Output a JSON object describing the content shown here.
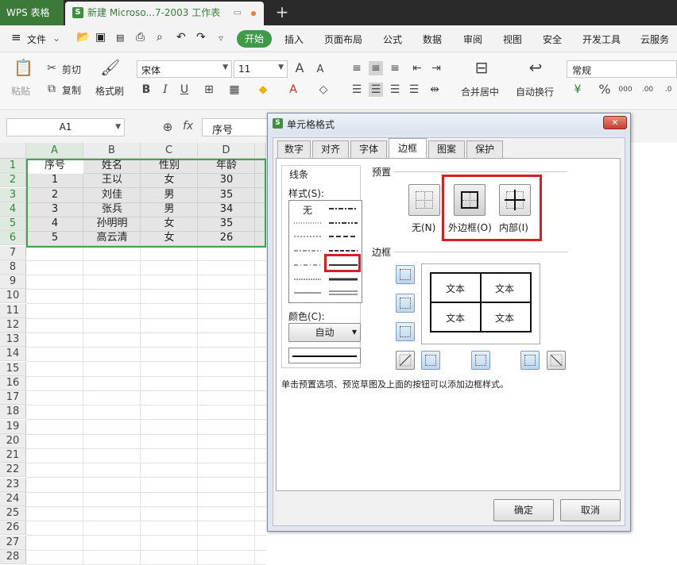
{
  "titlebar": {
    "app": "WPS 表格",
    "doc_title": "新建 Microso...7-2003 工作表"
  },
  "menu": {
    "file": "文件",
    "start": "开始",
    "items": [
      "插入",
      "页面布局",
      "公式",
      "数据",
      "审阅",
      "视图",
      "安全",
      "开发工具",
      "云服务"
    ]
  },
  "ribbon": {
    "paste": "粘贴",
    "cut": "剪切",
    "copy": "复制",
    "format_painter": "格式刷",
    "font_name": "宋体",
    "font_size": "11",
    "merge_center": "合并居中",
    "wrap_text": "自动换行",
    "number_format": "常规"
  },
  "formula": {
    "cell_ref": "A1",
    "fx": "fx",
    "value": "序号"
  },
  "sheet": {
    "columns": [
      "A",
      "B",
      "C",
      "D"
    ],
    "rows": [
      "1",
      "2",
      "3",
      "4",
      "5",
      "6",
      "7",
      "8",
      "9",
      "10",
      "11",
      "12",
      "13",
      "14",
      "15",
      "16",
      "17",
      "18",
      "19",
      "20",
      "21",
      "22",
      "23",
      "24",
      "25",
      "26",
      "27",
      "28"
    ],
    "data": [
      [
        "序号",
        "姓名",
        "性别",
        "年龄"
      ],
      [
        "1",
        "王以",
        "女",
        "30"
      ],
      [
        "2",
        "刘佳",
        "男",
        "35"
      ],
      [
        "3",
        "张兵",
        "男",
        "34"
      ],
      [
        "4",
        "孙明明",
        "女",
        "35"
      ],
      [
        "5",
        "高云清",
        "女",
        "26"
      ]
    ],
    "selection_color": "#3fa84a"
  },
  "dialog": {
    "title": "单元格格式",
    "tabs": [
      "数字",
      "对齐",
      "字体",
      "边框",
      "图案",
      "保护"
    ],
    "line_section": "线条",
    "style_label": "样式(S):",
    "style_none": "无",
    "color_label": "颜色(C):",
    "color_value": "自动",
    "preset_section": "预置",
    "preset_none": "无(N)",
    "preset_outline": "外边框(O)",
    "preset_inside": "内部(I)",
    "border_section": "边框",
    "preview_text": [
      "文本",
      "文本",
      "文本",
      "文本"
    ],
    "hint": "单击预置选项、预览草图及上面的按钮可以添加边框样式。",
    "ok": "确定",
    "cancel": "取消",
    "highlight_color": "#d81e1e"
  }
}
